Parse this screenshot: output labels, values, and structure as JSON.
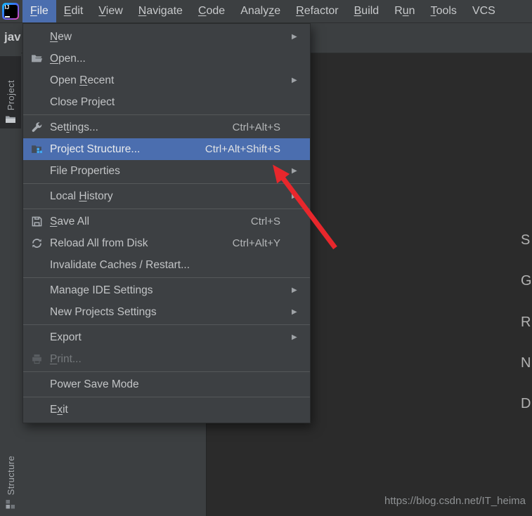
{
  "app": {
    "logo_text": "IJ"
  },
  "colors": {
    "selection_blue": "#4b6eaf",
    "menu_background": "#3c3f41",
    "editor_background": "#2b2b2b",
    "annotation_arrow_red": "#e8272c"
  },
  "menubar": {
    "items": [
      {
        "label": "File",
        "pre": "",
        "key": "F",
        "post": "ile",
        "selected": true
      },
      {
        "label": "Edit",
        "pre": "",
        "key": "E",
        "post": "dit"
      },
      {
        "label": "View",
        "pre": "",
        "key": "V",
        "post": "iew"
      },
      {
        "label": "Navigate",
        "pre": "",
        "key": "N",
        "post": "avigate"
      },
      {
        "label": "Code",
        "pre": "",
        "key": "C",
        "post": "ode"
      },
      {
        "label": "Analyze",
        "pre": "Analy",
        "key": "z",
        "post": "e"
      },
      {
        "label": "Refactor",
        "pre": "",
        "key": "R",
        "post": "efactor"
      },
      {
        "label": "Build",
        "pre": "",
        "key": "B",
        "post": "uild"
      },
      {
        "label": "Run",
        "pre": "R",
        "key": "u",
        "post": "n"
      },
      {
        "label": "Tools",
        "pre": "",
        "key": "T",
        "post": "ools"
      },
      {
        "label": "VCS",
        "pre": "VCS",
        "key": "",
        "post": ""
      }
    ]
  },
  "navbar": {
    "text": "jav"
  },
  "file_menu": {
    "items": [
      {
        "label": "New",
        "pre": "",
        "key": "N",
        "post": "ew",
        "submenu": true
      },
      {
        "label": "Open...",
        "pre": "",
        "key": "O",
        "post": "pen...",
        "icon": "folder-open-icon"
      },
      {
        "label": "Open Recent",
        "pre": "Open ",
        "key": "R",
        "post": "ecent",
        "submenu": true
      },
      {
        "label": "Close Project",
        "pre": "Close Project",
        "key": "",
        "post": ""
      },
      {
        "separator": true
      },
      {
        "label": "Settings...",
        "pre": "Set",
        "key": "t",
        "post": "ings...",
        "icon": "wrench-icon",
        "shortcut": "Ctrl+Alt+S"
      },
      {
        "label": "Project Structure...",
        "pre": "Project Structure...",
        "key": "",
        "post": "",
        "icon": "project-structure-icon",
        "shortcut": "Ctrl+Alt+Shift+S",
        "selected": true
      },
      {
        "label": "File Properties",
        "pre": "File Properties",
        "key": "",
        "post": "",
        "submenu": true
      },
      {
        "separator": true
      },
      {
        "label": "Local History",
        "pre": "Local ",
        "key": "H",
        "post": "istory",
        "submenu": true
      },
      {
        "separator": true
      },
      {
        "label": "Save All",
        "pre": "",
        "key": "S",
        "post": "ave All",
        "icon": "save-icon",
        "shortcut": "Ctrl+S"
      },
      {
        "label": "Reload All from Disk",
        "pre": "Reload All from Disk",
        "key": "",
        "post": "",
        "icon": "refresh-icon",
        "shortcut": "Ctrl+Alt+Y"
      },
      {
        "label": "Invalidate Caches / Restart...",
        "pre": "Invalidate Caches / Restart...",
        "key": "",
        "post": ""
      },
      {
        "separator": true
      },
      {
        "label": "Manage IDE Settings",
        "pre": "Manage IDE Settings",
        "key": "",
        "post": "",
        "submenu": true
      },
      {
        "label": "New Projects Settings",
        "pre": "New Projects Settings",
        "key": "",
        "post": "",
        "submenu": true
      },
      {
        "separator": true
      },
      {
        "label": "Export",
        "pre": "Export",
        "key": "",
        "post": "",
        "submenu": true
      },
      {
        "label": "Print...",
        "pre": "",
        "key": "P",
        "post": "rint...",
        "icon": "printer-icon",
        "disabled": true
      },
      {
        "separator": true
      },
      {
        "label": "Power Save Mode",
        "pre": "Power Save Mode",
        "key": "",
        "post": ""
      },
      {
        "separator": true
      },
      {
        "label": "Exit",
        "pre": "E",
        "key": "x",
        "post": "it"
      }
    ]
  },
  "tool_windows": {
    "project_label": "Project",
    "structure_label": "Structure"
  },
  "editor_hints": {
    "letters": [
      "S",
      "G",
      "R",
      "N",
      "D"
    ]
  },
  "watermark": {
    "text": "https://blog.csdn.net/IT_heima"
  }
}
